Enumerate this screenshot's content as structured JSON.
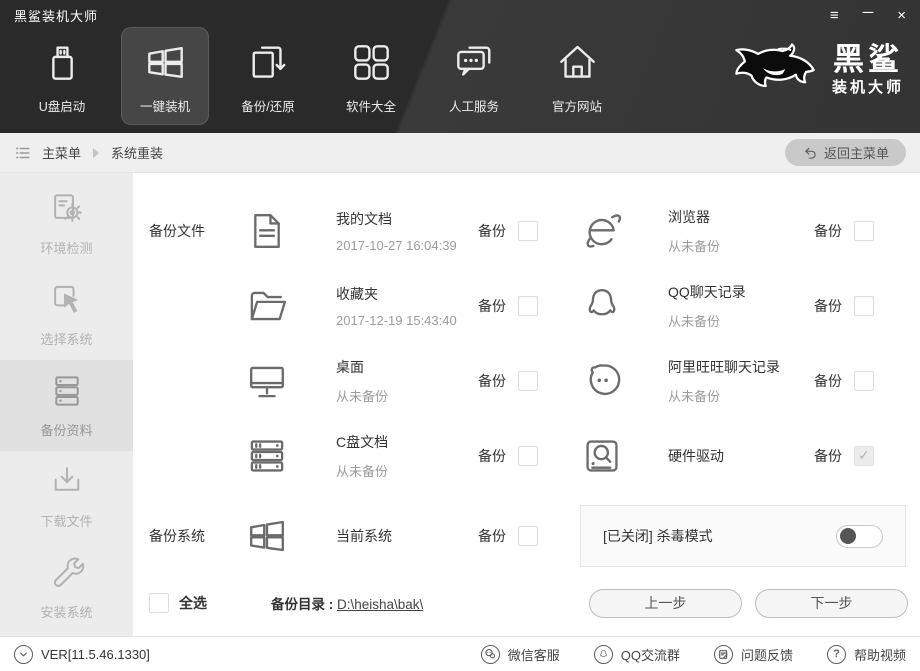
{
  "window": {
    "title": "黑鲨装机大师"
  },
  "nav": {
    "items": [
      {
        "label": "U盘启动"
      },
      {
        "label": "一键装机"
      },
      {
        "label": "备份/还原"
      },
      {
        "label": "软件大全"
      },
      {
        "label": "人工服务"
      },
      {
        "label": "官方网站"
      }
    ],
    "logo": {
      "line1": "黑鲨",
      "line2": "装机大师"
    }
  },
  "breadcrumb": {
    "root": "主菜单",
    "current": "系统重装",
    "return_label": "返回主菜单"
  },
  "sidebar": {
    "items": [
      {
        "label": "环境检测"
      },
      {
        "label": "选择系统"
      },
      {
        "label": "备份资料"
      },
      {
        "label": "下载文件"
      },
      {
        "label": "安装系统"
      }
    ]
  },
  "main": {
    "sections": {
      "files": "备份文件",
      "system": "备份系统"
    },
    "backup_label": "备份",
    "left_items": [
      {
        "title": "我的文档",
        "subtitle": "2017-10-27 16:04:39",
        "checked": false
      },
      {
        "title": "收藏夹",
        "subtitle": "2017-12-19 15:43:40",
        "checked": false
      },
      {
        "title": "桌面",
        "subtitle": "从未备份",
        "checked": false
      },
      {
        "title": "C盘文档",
        "subtitle": "从未备份",
        "checked": false
      },
      {
        "title": "当前系统",
        "subtitle": "",
        "checked": false
      }
    ],
    "right_items": [
      {
        "title": "浏览器",
        "subtitle": "从未备份",
        "checked": false
      },
      {
        "title": "QQ聊天记录",
        "subtitle": "从未备份",
        "checked": false
      },
      {
        "title": "阿里旺旺聊天记录",
        "subtitle": "从未备份",
        "checked": false
      },
      {
        "title": "硬件驱动",
        "subtitle": "",
        "checked": true
      }
    ],
    "antivirus": {
      "label": "[已关闭] 杀毒模式",
      "on": false
    },
    "select_all": "全选",
    "dir_label": "备份目录 : ",
    "dir_path": "D:\\heisha\\bak\\",
    "prev_button": "上一步",
    "next_button": "下一步"
  },
  "footer": {
    "version": "VER[11.5.46.1330]",
    "links": [
      {
        "label": "微信客服"
      },
      {
        "label": "QQ交流群"
      },
      {
        "label": "问题反馈"
      },
      {
        "label": "帮助视频"
      }
    ]
  }
}
